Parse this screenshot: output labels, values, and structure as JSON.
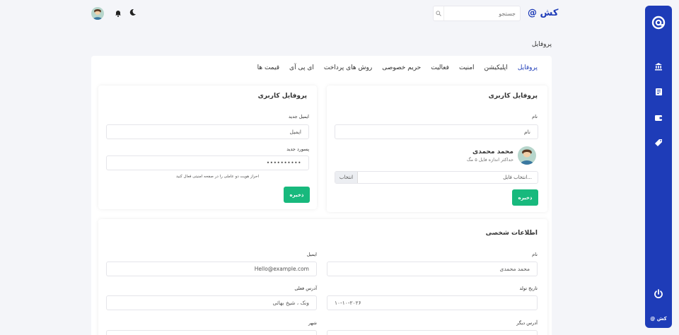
{
  "brand": {
    "name": "کش",
    "sidebar_label": "کش"
  },
  "search": {
    "placeholder": "جستجو"
  },
  "page_title": "پروفایل",
  "tabs": [
    {
      "label": "پروفایل",
      "active": true
    },
    {
      "label": "اپلیکیشن"
    },
    {
      "label": "امنیت"
    },
    {
      "label": "فعالیت"
    },
    {
      "label": "حریم خصوصی"
    },
    {
      "label": "روش های پرداخت"
    },
    {
      "label": "ای پی آی"
    },
    {
      "label": "قیمت ها"
    }
  ],
  "profile_card": {
    "title": "پروفایل کاربری",
    "name_label": "نام",
    "name_value": "نام",
    "user_name": "محمد محمدی",
    "user_hint": "حداکثر اندازه فایل ۵ مگ",
    "file_name": "انتخاب فایل...",
    "file_button": "انتخاب",
    "save": "ذخیره"
  },
  "account_card": {
    "title": "پروفایل کاربری",
    "email_label": "ایمیل جدید",
    "email_value": "ایمیل",
    "password_label": "پسورد جدید",
    "password_value": "••••••••••",
    "hint": "احراز هویت دو عاملی را در صفحه امنیتی فعال کنید",
    "save": "ذخیره"
  },
  "personal": {
    "title": "اطلاعات شخصی",
    "name_label": "نام",
    "name_value": "محمد محمدی",
    "email_label": "ایمیل",
    "email_value": "Hello@example.com",
    "birth_label": "تاریخ تولد",
    "birth_value": "۱۰-۱۰-۲۰۲۶",
    "address_label": "آدرس فعلی",
    "address_value": "ونک ، شیخ بهائی",
    "other_address_label": "آدرس دیگر",
    "city_label": "شهر"
  },
  "colors": {
    "primary": "#1e3cb8",
    "success": "#18b97d",
    "background": "#f4f5f9"
  }
}
